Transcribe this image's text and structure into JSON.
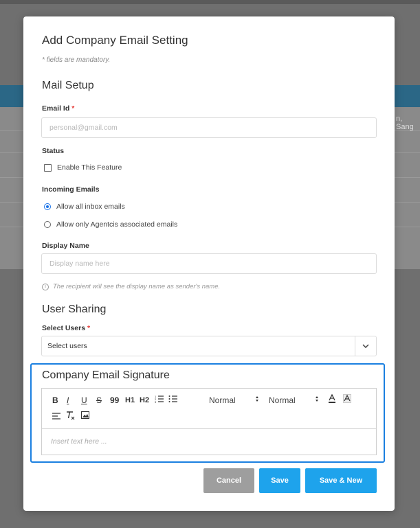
{
  "modal": {
    "title": "Add Company Email Setting",
    "mandatory_note": "* fields are mandatory."
  },
  "mail_setup": {
    "section_title": "Mail Setup",
    "email_label": "Email Id",
    "required_mark": "*",
    "email_placeholder": "personal@gmail.com",
    "status_label": "Status",
    "enable_label": "Enable This Feature",
    "enable_checked": false,
    "incoming_label": "Incoming Emails",
    "incoming_options": [
      {
        "label": "Allow all inbox emails",
        "selected": true
      },
      {
        "label": "Allow only Agentcis associated emails",
        "selected": false
      }
    ],
    "display_name_label": "Display Name",
    "display_name_placeholder": "Display name here",
    "display_hint": "The recipient will see the display name as sender's name."
  },
  "user_sharing": {
    "section_title": "User Sharing",
    "select_label": "Select Users",
    "required_mark": "*",
    "select_value": "Select users"
  },
  "signature": {
    "section_title": "Company Email Signature",
    "toolbar": {
      "bold": "B",
      "italic": "I",
      "underline": "U",
      "strike": "S",
      "quote": "99",
      "h1": "H1",
      "h2": "H2",
      "font_select": "Normal",
      "size_select": "Normal"
    },
    "placeholder": "Insert text here ..."
  },
  "footer": {
    "cancel": "Cancel",
    "save": "Save",
    "save_new": "Save & New"
  },
  "background": {
    "peek_text": "n, Sang"
  },
  "colors": {
    "accent": "#1ea3ec",
    "focus_border": "#1a7fe0",
    "required": "#e53935",
    "cancel": "#9e9e9e"
  }
}
